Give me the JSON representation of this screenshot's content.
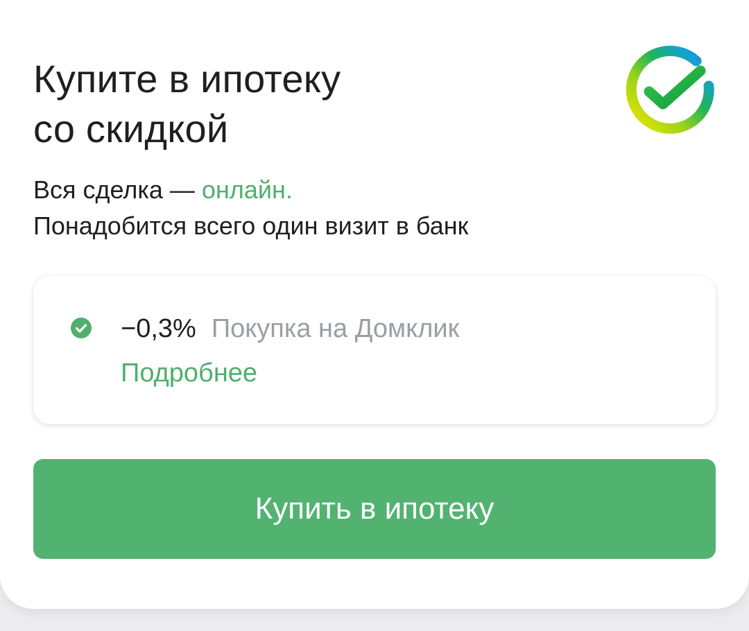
{
  "card": {
    "title_line1": "Купите в ипотеку",
    "title_line2": "со скидкой",
    "logo_icon": "sber-checkmark-logo-icon",
    "subtitle_prefix": "Вся сделка — ",
    "subtitle_accent": "онлайн.",
    "subtitle_line2": "Понадобится всего один визит в банк"
  },
  "offer": {
    "icon": "check-circle-icon",
    "discount": "−0,3%",
    "label": "Покупка на Домклик",
    "link": "Подробнее"
  },
  "cta": {
    "label": "Купить в ипотеку"
  },
  "colors": {
    "accent_green": "#4faf6c",
    "button_green": "#52b371",
    "text_dark": "#1f1f1f",
    "text_muted": "#9b9ea3"
  }
}
